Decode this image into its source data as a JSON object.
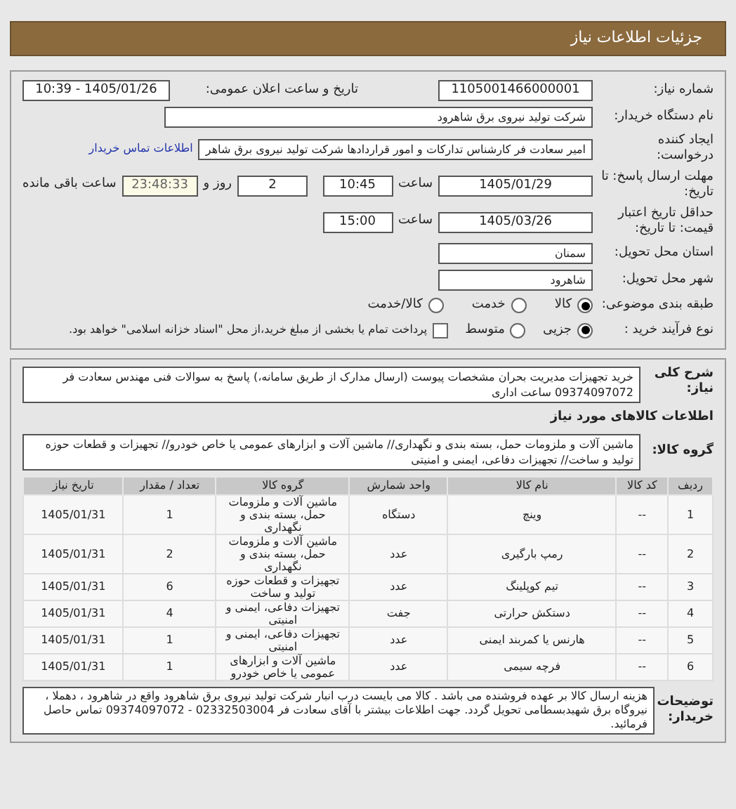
{
  "header": {
    "title": "جزئیات اطلاعات نیاز"
  },
  "need_number": {
    "label": "شماره نیاز:",
    "value": "1105001466000001"
  },
  "announce": {
    "label": "تاریخ و ساعت اعلان عمومی:",
    "value": "1405/01/26 - 10:39"
  },
  "buyer": {
    "label": "نام دستگاه خریدار:",
    "value": "شرکت تولید نیروی برق شاهرود"
  },
  "requester": {
    "label": "ایجاد کننده درخواست:",
    "value": "امیر سعادت فر کارشناس تدارکات و امور قراردادها شرکت تولید نیروی برق شاهر",
    "link": "اطلاعات تماس خریدار"
  },
  "deadline": {
    "label": "مهلت ارسال پاسخ: تا تاریخ:",
    "date": "1405/01/29",
    "time_label": "ساعت",
    "time": "10:45",
    "days": "2",
    "days_label": "روز و",
    "remaining": "23:48:33",
    "remaining_label": "ساعت باقی مانده"
  },
  "validity": {
    "label": "حداقل تاریخ اعتبار قیمت: تا تاریخ:",
    "date": "1405/03/26",
    "time_label": "ساعت",
    "time": "15:00"
  },
  "province": {
    "label": "استان محل تحویل:",
    "value": "سمنان"
  },
  "city": {
    "label": "شهر محل تحویل:",
    "value": "شاهرود"
  },
  "category": {
    "label": "طبقه بندی موضوعی:",
    "options": [
      {
        "label": "کالا",
        "selected": true
      },
      {
        "label": "خدمت",
        "selected": false
      },
      {
        "label": "کالا/خدمت",
        "selected": false
      }
    ]
  },
  "purchase_type": {
    "label": "نوع فرآیند خرید :",
    "options": [
      {
        "label": "جزیی",
        "selected": true
      },
      {
        "label": "متوسط",
        "selected": false
      }
    ],
    "payment": {
      "label": "پرداخت تمام یا بخشی از مبلغ خرید،از محل \"اسناد خزانه اسلامی\" خواهد بود.",
      "checked": false
    }
  },
  "description": {
    "label": "شرح کلی نیاز:",
    "value": "خرید تجهیزات مدیریت بحران مشخصات پیوست (ارسال مدارک از طریق سامانه،) پاسخ به سوالات فنی مهندس سعادت فر 09374097072 ساعت اداری"
  },
  "goods_heading": "اطلاعات کالاهای مورد نیاز",
  "goods_group": {
    "label": "گروه کالا:",
    "value": "ماشین آلات و ملزومات حمل، بسته بندی و نگهداری// ماشین آلات و ابزارهای عمومی یا خاص خودرو// تجهیزات و قطعات حوزه تولید و ساخت// تجهیزات دفاعی، ایمنی و امنیتی"
  },
  "table": {
    "columns": [
      "ردیف",
      "کد کالا",
      "نام کالا",
      "واحد شمارش",
      "گروه کالا",
      "تعداد / مقدار",
      "تاریخ نیاز"
    ],
    "rows": [
      [
        "1",
        "--",
        "وینچ",
        "دستگاه",
        "ماشین آلات و ملزومات حمل، بسته بندی و نگهداری",
        "1",
        "1405/01/31"
      ],
      [
        "2",
        "--",
        "رمپ بارگیری",
        "عدد",
        "ماشین آلات و ملزومات حمل، بسته بندی و نگهداری",
        "2",
        "1405/01/31"
      ],
      [
        "3",
        "--",
        "تیم کوپلینگ",
        "عدد",
        "تجهیزات و قطعات حوزه تولید و ساخت",
        "6",
        "1405/01/31"
      ],
      [
        "4",
        "--",
        "دستکش حرارتی",
        "جفت",
        "تجهیزات دفاعی، ایمنی و امنیتی",
        "4",
        "1405/01/31"
      ],
      [
        "5",
        "--",
        "هارنس یا کمربند ایمنی",
        "عدد",
        "تجهیزات دفاعی، ایمنی و امنیتی",
        "1",
        "1405/01/31"
      ],
      [
        "6",
        "--",
        "فرچه سیمی",
        "عدد",
        "ماشین آلات و ابزارهای عمومی یا خاص خودرو",
        "1",
        "1405/01/31"
      ]
    ]
  },
  "notes": {
    "label": "توضیحات خریدار:",
    "value": "هزینه ارسال کالا بر عهده فروشنده می باشد . کالا می بایست درب انبار شرکت تولید نیروی برق شاهرود واقع در شاهرود ، دهملا ، نیروگاه برق شهیدبسطامی تحویل گردد. جهت اطلاعات بیشتر با آقای سعادت فر 02332503004 - 09374097072 تماس حاصل فرمائید."
  }
}
